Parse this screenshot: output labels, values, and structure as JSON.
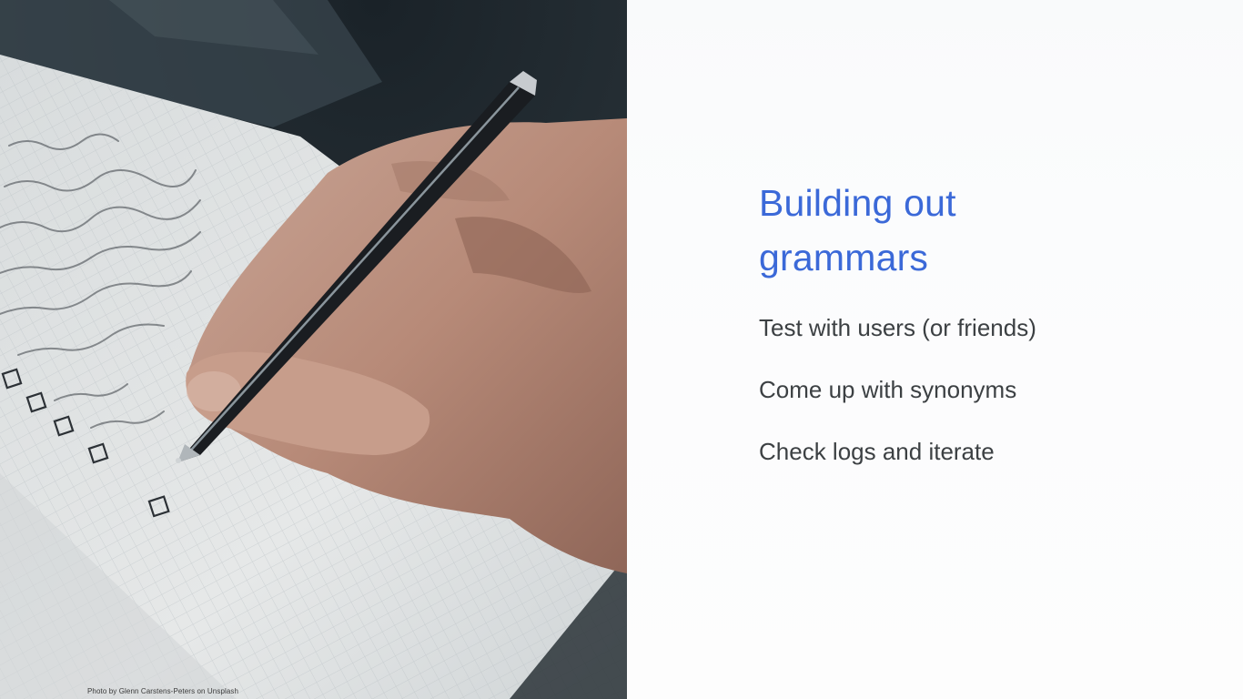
{
  "slide": {
    "title_line1": "Building out",
    "title_line2": "grammars",
    "bullets": [
      "Test with users (or friends)",
      "Come up with synonyms",
      "Check logs and iterate"
    ],
    "photo_credit": "Photo by Glenn Carstens-Peters on Unsplash"
  },
  "colors": {
    "title": "#3b69d8",
    "body_text": "#3c4043",
    "background": "#fdfdfd"
  }
}
